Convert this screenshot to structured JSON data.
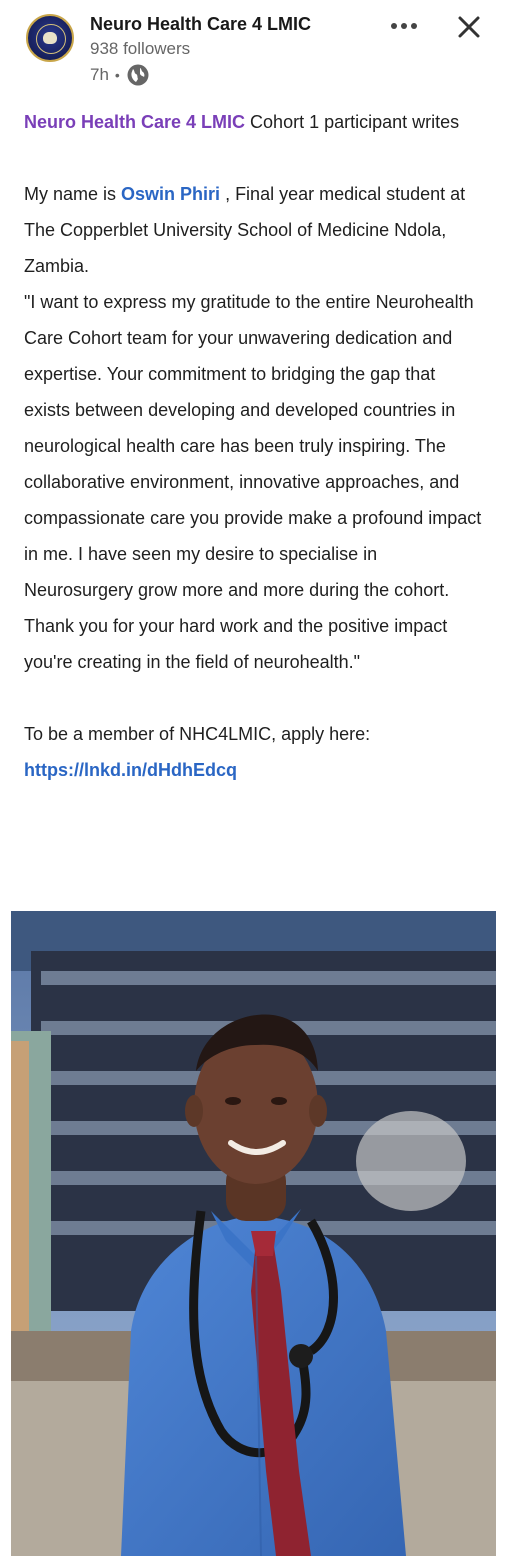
{
  "header": {
    "org_name": "Neuro Health Care 4 LMIC",
    "followers": "938 followers",
    "time": "7h",
    "dot": "•",
    "visibility_icon": "globe-icon",
    "more_icon": "more-horizontal-icon",
    "close_icon": "close-icon"
  },
  "post": {
    "line1_mention": "Neuro Health Care 4 LMIC",
    "line1_rest": " Cohort 1 participant writes",
    "para2_start": "My name is ",
    "para2_mention": "Oswin Phiri",
    "para2_rest": " , Final year medical student at The Copperblet University School of Medicine Ndola, Zambia.",
    "quote": "\"I want to express my gratitude to the entire Neurohealth Care Cohort team for your unwavering dedication and expertise. Your commitment to bridging the gap that exists between developing and developed countries in neurological health care has been truly inspiring. The collaborative environment, innovative approaches, and compassionate care you provide make a profound impact in me. I have seen my desire to specialise in Neurosurgery grow more and more during the cohort. Thank you for your hard work and the positive impact you're creating in the field of neurohealth.\"",
    "apply_text": "To be a member of NHC4LMIC, apply here:",
    "apply_link": "https://lnkd.in/dHdhEdcq"
  },
  "colors": {
    "company_mention": "#7a3fb8",
    "link_blue": "#2a66c4",
    "muted_text": "#666666"
  },
  "image": {
    "subject": "photo of smiling medical student in blue shirt and red tie with stethoscope"
  }
}
